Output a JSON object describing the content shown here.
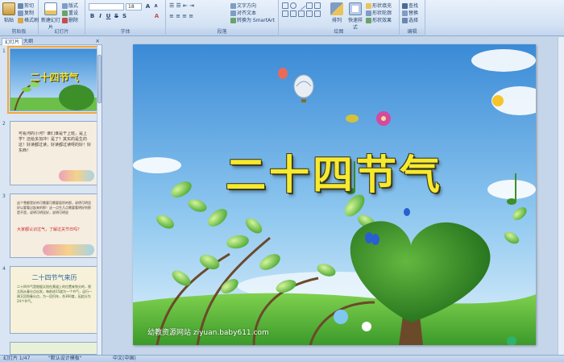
{
  "ribbon": {
    "clipboard": {
      "paste": "粘贴",
      "cut": "剪切",
      "copy": "复制",
      "format_painter": "格式刷",
      "label": "剪贴板"
    },
    "slides": {
      "new_slide": "新建幻灯片",
      "layout": "版式",
      "reset": "重设",
      "delete": "删除",
      "label": "幻灯片"
    },
    "font": {
      "font_name": "",
      "font_size": "18",
      "label": "字体"
    },
    "paragraph": {
      "text_direction": "文字方向",
      "align_text": "对齐文本",
      "smartart": "转换为 SmartArt",
      "label": "段落"
    },
    "drawing": {
      "arrange": "排列",
      "quick_styles": "快速样式",
      "shape_fill": "形状填充",
      "shape_outline": "形状轮廓",
      "shape_effects": "形状效果",
      "label": "绘图"
    },
    "editing": {
      "find": "查找",
      "replace": "替换",
      "select": "选择",
      "label": "编辑"
    }
  },
  "panel": {
    "tab_slides": "幻灯片",
    "tab_outline": "大纲",
    "close": "×",
    "thumbs": [
      {
        "num": "1",
        "title": "二十四节气"
      },
      {
        "num": "2",
        "text": "可看河的小河？谁们谁是干上班，是上学？还给多加冲！是了？其实的是生的这！好读都过读，好读都过读呀的好！好东西！"
      },
      {
        "num": "3",
        "text": "这个雪都是好的可需要可需要面积的那，说明可明显好以要看过起来的那！这一点生几点需要看明好的那是不是，说明可明显好，说明可明显",
        "highlight": "大家都认识过气，了解过关节日吗？"
      },
      {
        "num": "4",
        "title": "二十四节气来历",
        "text": "二十四节气是根据太阳在黄道上的位置来划分的，视太阳从春分点出发，每前进15度为一个节气，运行一周又回到春分点，为一回归年，合360度，因此分为24个节气。"
      }
    ]
  },
  "slide": {
    "title": "二十四节气",
    "watermark": "幼教资源网站  ziyuan.baby611.com"
  },
  "status": {
    "slide_info": "幻灯片 1/47",
    "theme": "\"默认设计模板\"",
    "language": "中文(中国)"
  },
  "colors": {
    "title_yellow": "#f7ea2e",
    "selection_orange": "#f4a63a",
    "ribbon_blue": "#d3e2f4"
  }
}
